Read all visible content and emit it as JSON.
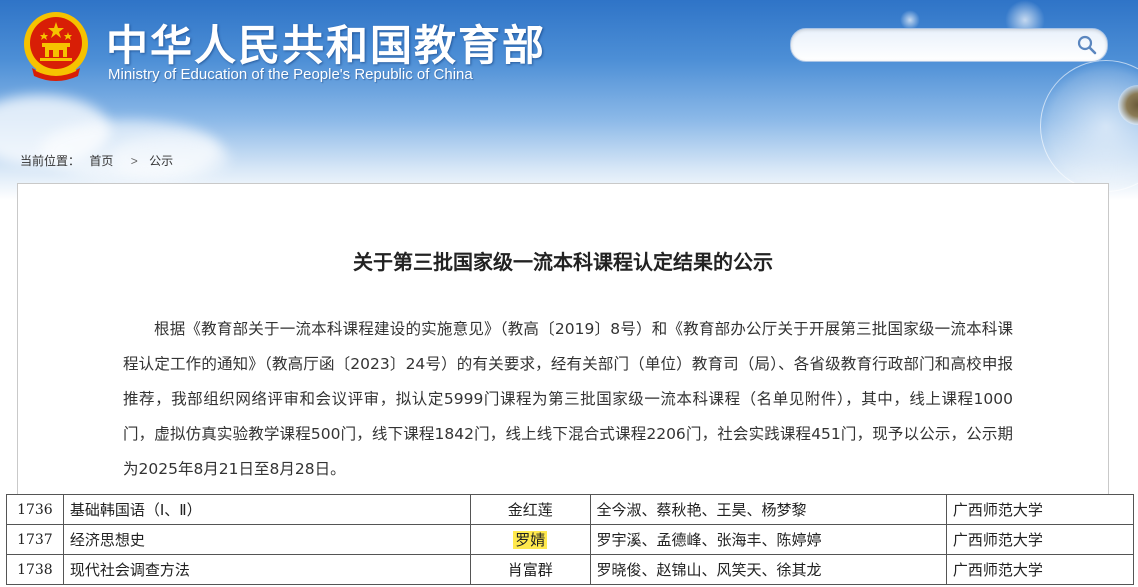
{
  "header": {
    "title": "中华人民共和国教育部",
    "subtitle": "Ministry of Education of the People's Republic of China",
    "search": {
      "value": "",
      "placeholder": ""
    }
  },
  "breadcrumb": {
    "prefix": "当前位置：",
    "items": [
      "首页",
      "公示"
    ],
    "separator": ">"
  },
  "article": {
    "title": "关于第三批国家级一流本科课程认定结果的公示",
    "body": "根据《教育部关于一流本科课程建设的实施意见》（教高〔2019〕8号）和《教育部办公厅关于开展第三批国家级一流本科课程认定工作的通知》（教高厅函〔2023〕24号）的有关要求，经有关部门（单位）教育司（局）、各省级教育行政部门和高校申报推荐，我部组织网络评审和会议评审，拟认定5999门课程为第三批国家级一流本科课程（名单见附件），其中，线上课程1000门，虚拟仿真实验教学课程500门，线下课程1842门，线上线下混合式课程2206门，社会实践课程451门，现予以公示，公示期为2025年8月21日至8月28日。"
  },
  "table": {
    "rows": [
      {
        "num": "1736",
        "name": "基础韩国语（Ⅰ、Ⅱ）",
        "lead": "金红莲",
        "members": "全今淑、蔡秋艳、王昊、杨梦黎",
        "school": "广西师范大学"
      },
      {
        "num": "1737",
        "name": "经济思想史",
        "lead": "罗婧",
        "members": "罗宇溪、孟德峰、张海丰、陈婷婷",
        "school": "广西师范大学"
      },
      {
        "num": "1738",
        "name": "现代社会调查方法",
        "lead": "肖富群",
        "members": "罗晓俊、赵锦山、风笑天、徐其龙",
        "school": "广西师范大学"
      }
    ]
  },
  "colors": {
    "header_top": "#2f74c7",
    "highlight": "#ffe94d",
    "emblem_red": "#d81e06",
    "emblem_gold": "#f6c200"
  },
  "icons": [
    "national-emblem-icon",
    "search-icon"
  ]
}
